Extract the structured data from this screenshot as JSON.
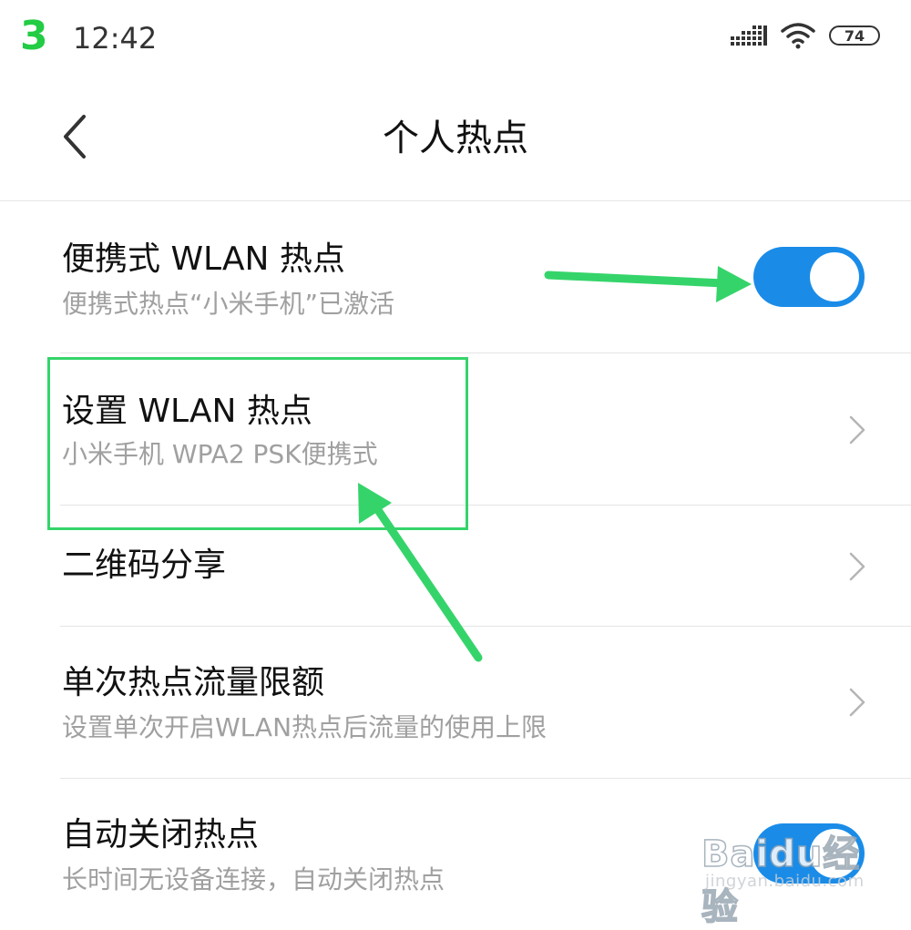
{
  "annotation": {
    "step_number": "3",
    "arrow_color": "#35d46a"
  },
  "status_bar": {
    "time": "12:42",
    "battery": "74",
    "icons": [
      "signal-icon",
      "wifi-icon",
      "battery-icon"
    ]
  },
  "header": {
    "title": "个人热点",
    "back_icon": "chevron-left-icon"
  },
  "rows": [
    {
      "title": "便携式 WLAN 热点",
      "subtitle": "便携式热点“小米手机”已激活",
      "control": "toggle",
      "toggle_on": true
    },
    {
      "title": "设置 WLAN 热点",
      "subtitle": "小米手机 WPA2 PSK便携式",
      "control": "chevron"
    },
    {
      "title": "二维码分享",
      "control": "chevron"
    },
    {
      "title": "单次热点流量限额",
      "subtitle": "设置单次开启WLAN热点后流量的使用上限",
      "control": "chevron"
    },
    {
      "title": "自动关闭热点",
      "subtitle": "长时间无设备连接，自动关闭热点",
      "control": "toggle",
      "toggle_on": true
    }
  ],
  "colors": {
    "accent": "#1a8ce8",
    "subtitle": "#a0a0a0",
    "annotation": "#35d46a"
  },
  "watermark": {
    "logo": "Baidu经验",
    "url": "jingyan.baidu.com"
  }
}
